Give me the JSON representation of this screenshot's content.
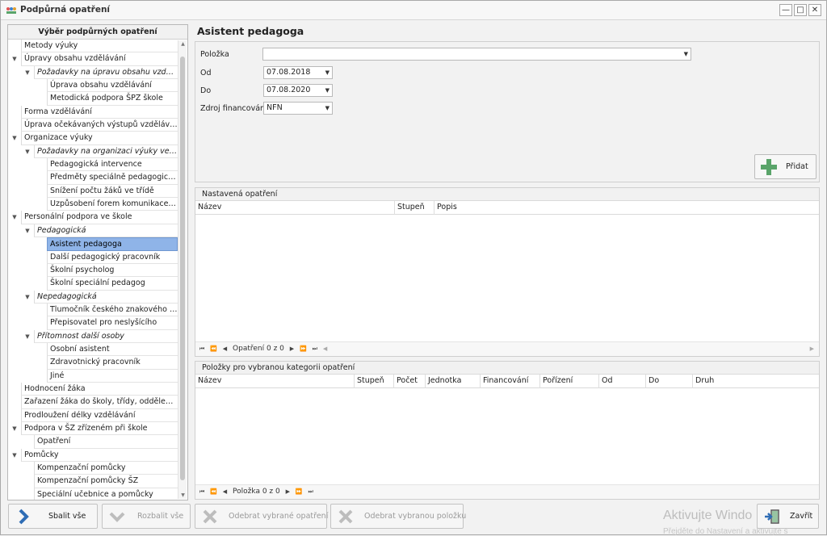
{
  "window": {
    "title": "Podpůrná opatření",
    "controls": {
      "minimize": "—",
      "maximize": "□",
      "close": "✕"
    }
  },
  "tree": {
    "header": "Výběr podpůrných opatření",
    "items": [
      {
        "label": "Metody výuky",
        "level": 0,
        "expander": false,
        "italic": false
      },
      {
        "label": "Úpravy obsahu vzdělávání",
        "level": 0,
        "expander": true,
        "italic": false
      },
      {
        "label": "Požadavky na úpravu obsahu vzděl...",
        "level": 1,
        "expander": true,
        "italic": true
      },
      {
        "label": "Úprava obsahu vzdělávání",
        "level": 2,
        "expander": false,
        "italic": false
      },
      {
        "label": "Metodická podpora ŠPZ škole",
        "level": 2,
        "expander": false,
        "italic": false
      },
      {
        "label": "Forma vzdělávání",
        "level": 0,
        "expander": false,
        "italic": false
      },
      {
        "label": "Úprava očekávaných výstupů vzdělávání",
        "level": 0,
        "expander": false,
        "italic": false
      },
      {
        "label": "Organizace výuky",
        "level": 0,
        "expander": true,
        "italic": false
      },
      {
        "label": "Požadavky na organizaci výuky ve škole",
        "level": 1,
        "expander": true,
        "italic": true
      },
      {
        "label": "Pedagogická intervence",
        "level": 2,
        "expander": false,
        "italic": false
      },
      {
        "label": "Předměty speciálně pedagogické p...",
        "level": 2,
        "expander": false,
        "italic": false
      },
      {
        "label": "Snížení počtu žáků ve třídě",
        "level": 2,
        "expander": false,
        "italic": false
      },
      {
        "label": "Uzpůsobení forem komunikace a zp...",
        "level": 2,
        "expander": false,
        "italic": false
      },
      {
        "label": "Personální podpora ve škole",
        "level": 0,
        "expander": true,
        "italic": false
      },
      {
        "label": "Pedagogická",
        "level": 1,
        "expander": true,
        "italic": true
      },
      {
        "label": "Asistent pedagoga",
        "level": 2,
        "expander": false,
        "italic": false,
        "selected": true
      },
      {
        "label": "Další pedagogický pracovník",
        "level": 2,
        "expander": false,
        "italic": false
      },
      {
        "label": "Školní psycholog",
        "level": 2,
        "expander": false,
        "italic": false
      },
      {
        "label": "Školní speciální pedagog",
        "level": 2,
        "expander": false,
        "italic": false
      },
      {
        "label": "Nepedagogická",
        "level": 1,
        "expander": true,
        "italic": true
      },
      {
        "label": "Tlumočník českého znakového jazyka",
        "level": 2,
        "expander": false,
        "italic": false
      },
      {
        "label": "Přepisovatel pro neslyšícího",
        "level": 2,
        "expander": false,
        "italic": false
      },
      {
        "label": "Přítomnost další osoby",
        "level": 1,
        "expander": true,
        "italic": true
      },
      {
        "label": "Osobní asistent",
        "level": 2,
        "expander": false,
        "italic": false
      },
      {
        "label": "Zdravotnický pracovník",
        "level": 2,
        "expander": false,
        "italic": false
      },
      {
        "label": "Jiné",
        "level": 2,
        "expander": false,
        "italic": false
      },
      {
        "label": "Hodnocení žáka",
        "level": 0,
        "expander": false,
        "italic": false
      },
      {
        "label": "Zařazení žáka do školy, třídy, oddělení, sk...",
        "level": 0,
        "expander": false,
        "italic": false
      },
      {
        "label": "Prodloužení délky vzdělávání",
        "level": 0,
        "expander": false,
        "italic": false
      },
      {
        "label": "Podpora v ŠZ zřízeném při škole",
        "level": 0,
        "expander": true,
        "italic": false
      },
      {
        "label": "Opatření",
        "level": 1,
        "expander": false,
        "italic": false
      },
      {
        "label": "Pomůcky",
        "level": 0,
        "expander": true,
        "italic": false
      },
      {
        "label": "Kompenzační pomůcky",
        "level": 1,
        "expander": false,
        "italic": false
      },
      {
        "label": "Kompenzační pomůcky ŠZ",
        "level": 1,
        "expander": false,
        "italic": false
      },
      {
        "label": "Speciální učebnice a pomůcky",
        "level": 1,
        "expander": false,
        "italic": false
      }
    ]
  },
  "detail": {
    "title": "Asistent pedagoga",
    "fields": {
      "polozka": {
        "label": "Položka",
        "value": ""
      },
      "od": {
        "label": "Od",
        "value": "07.08.2018"
      },
      "do": {
        "label": "Do",
        "value": "07.08.2020"
      },
      "zdroj": {
        "label": "Zdroj financování",
        "value": "NFN"
      }
    },
    "add_label": "Přidat"
  },
  "grid1": {
    "caption": "Nastavená opatření",
    "columns": [
      "Název",
      "Stupeň",
      "Popis"
    ],
    "footer": "Opatření 0 z 0"
  },
  "grid2": {
    "caption": "Položky pro vybranou kategorii opatření",
    "columns": [
      "Název",
      "Stupeň",
      "Počet",
      "Jednotka",
      "Financování",
      "Pořízení",
      "Od",
      "Do",
      "Druh"
    ],
    "footer": "Položka 0 z 0"
  },
  "buttons": {
    "collapse_all": "Sbalit vše",
    "expand_all": "Rozbalit vše",
    "remove_measure": "Odebrat vybrané opatření",
    "remove_item": "Odebrat vybranou položku",
    "close": "Zavřít"
  },
  "watermark": {
    "line1": "Aktivujte Windo",
    "line2": "Přejděte do Nastavení a aktivujte s"
  },
  "colors": {
    "selection": "#8fb4e8",
    "add_icon": "#5aa46a",
    "collapse_icon": "#2f6db5",
    "disabled_icon": "#bdbdbd"
  }
}
